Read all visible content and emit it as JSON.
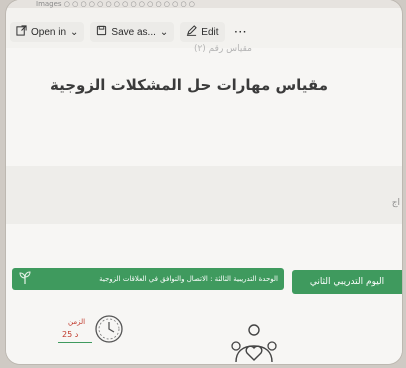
{
  "window": {
    "tab_strip_text": "Images ○ ○ ○ ○ ○ ○ ○ ○ ○ ○ ○ ○ ○ ○ ○ ○"
  },
  "toolbar": {
    "open_in_label": "Open in",
    "save_as_label": "Save as...",
    "edit_label": "Edit",
    "more_label": "···"
  },
  "document": {
    "ghost_heading": "مقياس رقم (٢)",
    "title": "مقياس مهارات حل المشكلات الزوجية",
    "side_char": "اج",
    "unit_bar_text": "الوحدة التدريبية الثالثة : الاتصال والتوافق في العلاقات الزوجية",
    "day_label": "اليوم التدريبي الثاني",
    "time_label": "الزمن",
    "time_value": "25 د"
  },
  "colors": {
    "accent_green": "#3f9a5e",
    "time_red": "#c0392b"
  },
  "icons": [
    "open-in-icon",
    "save-as-icon",
    "edit-pencil-icon",
    "plant-icon",
    "clock-icon",
    "family-care-icon"
  ]
}
